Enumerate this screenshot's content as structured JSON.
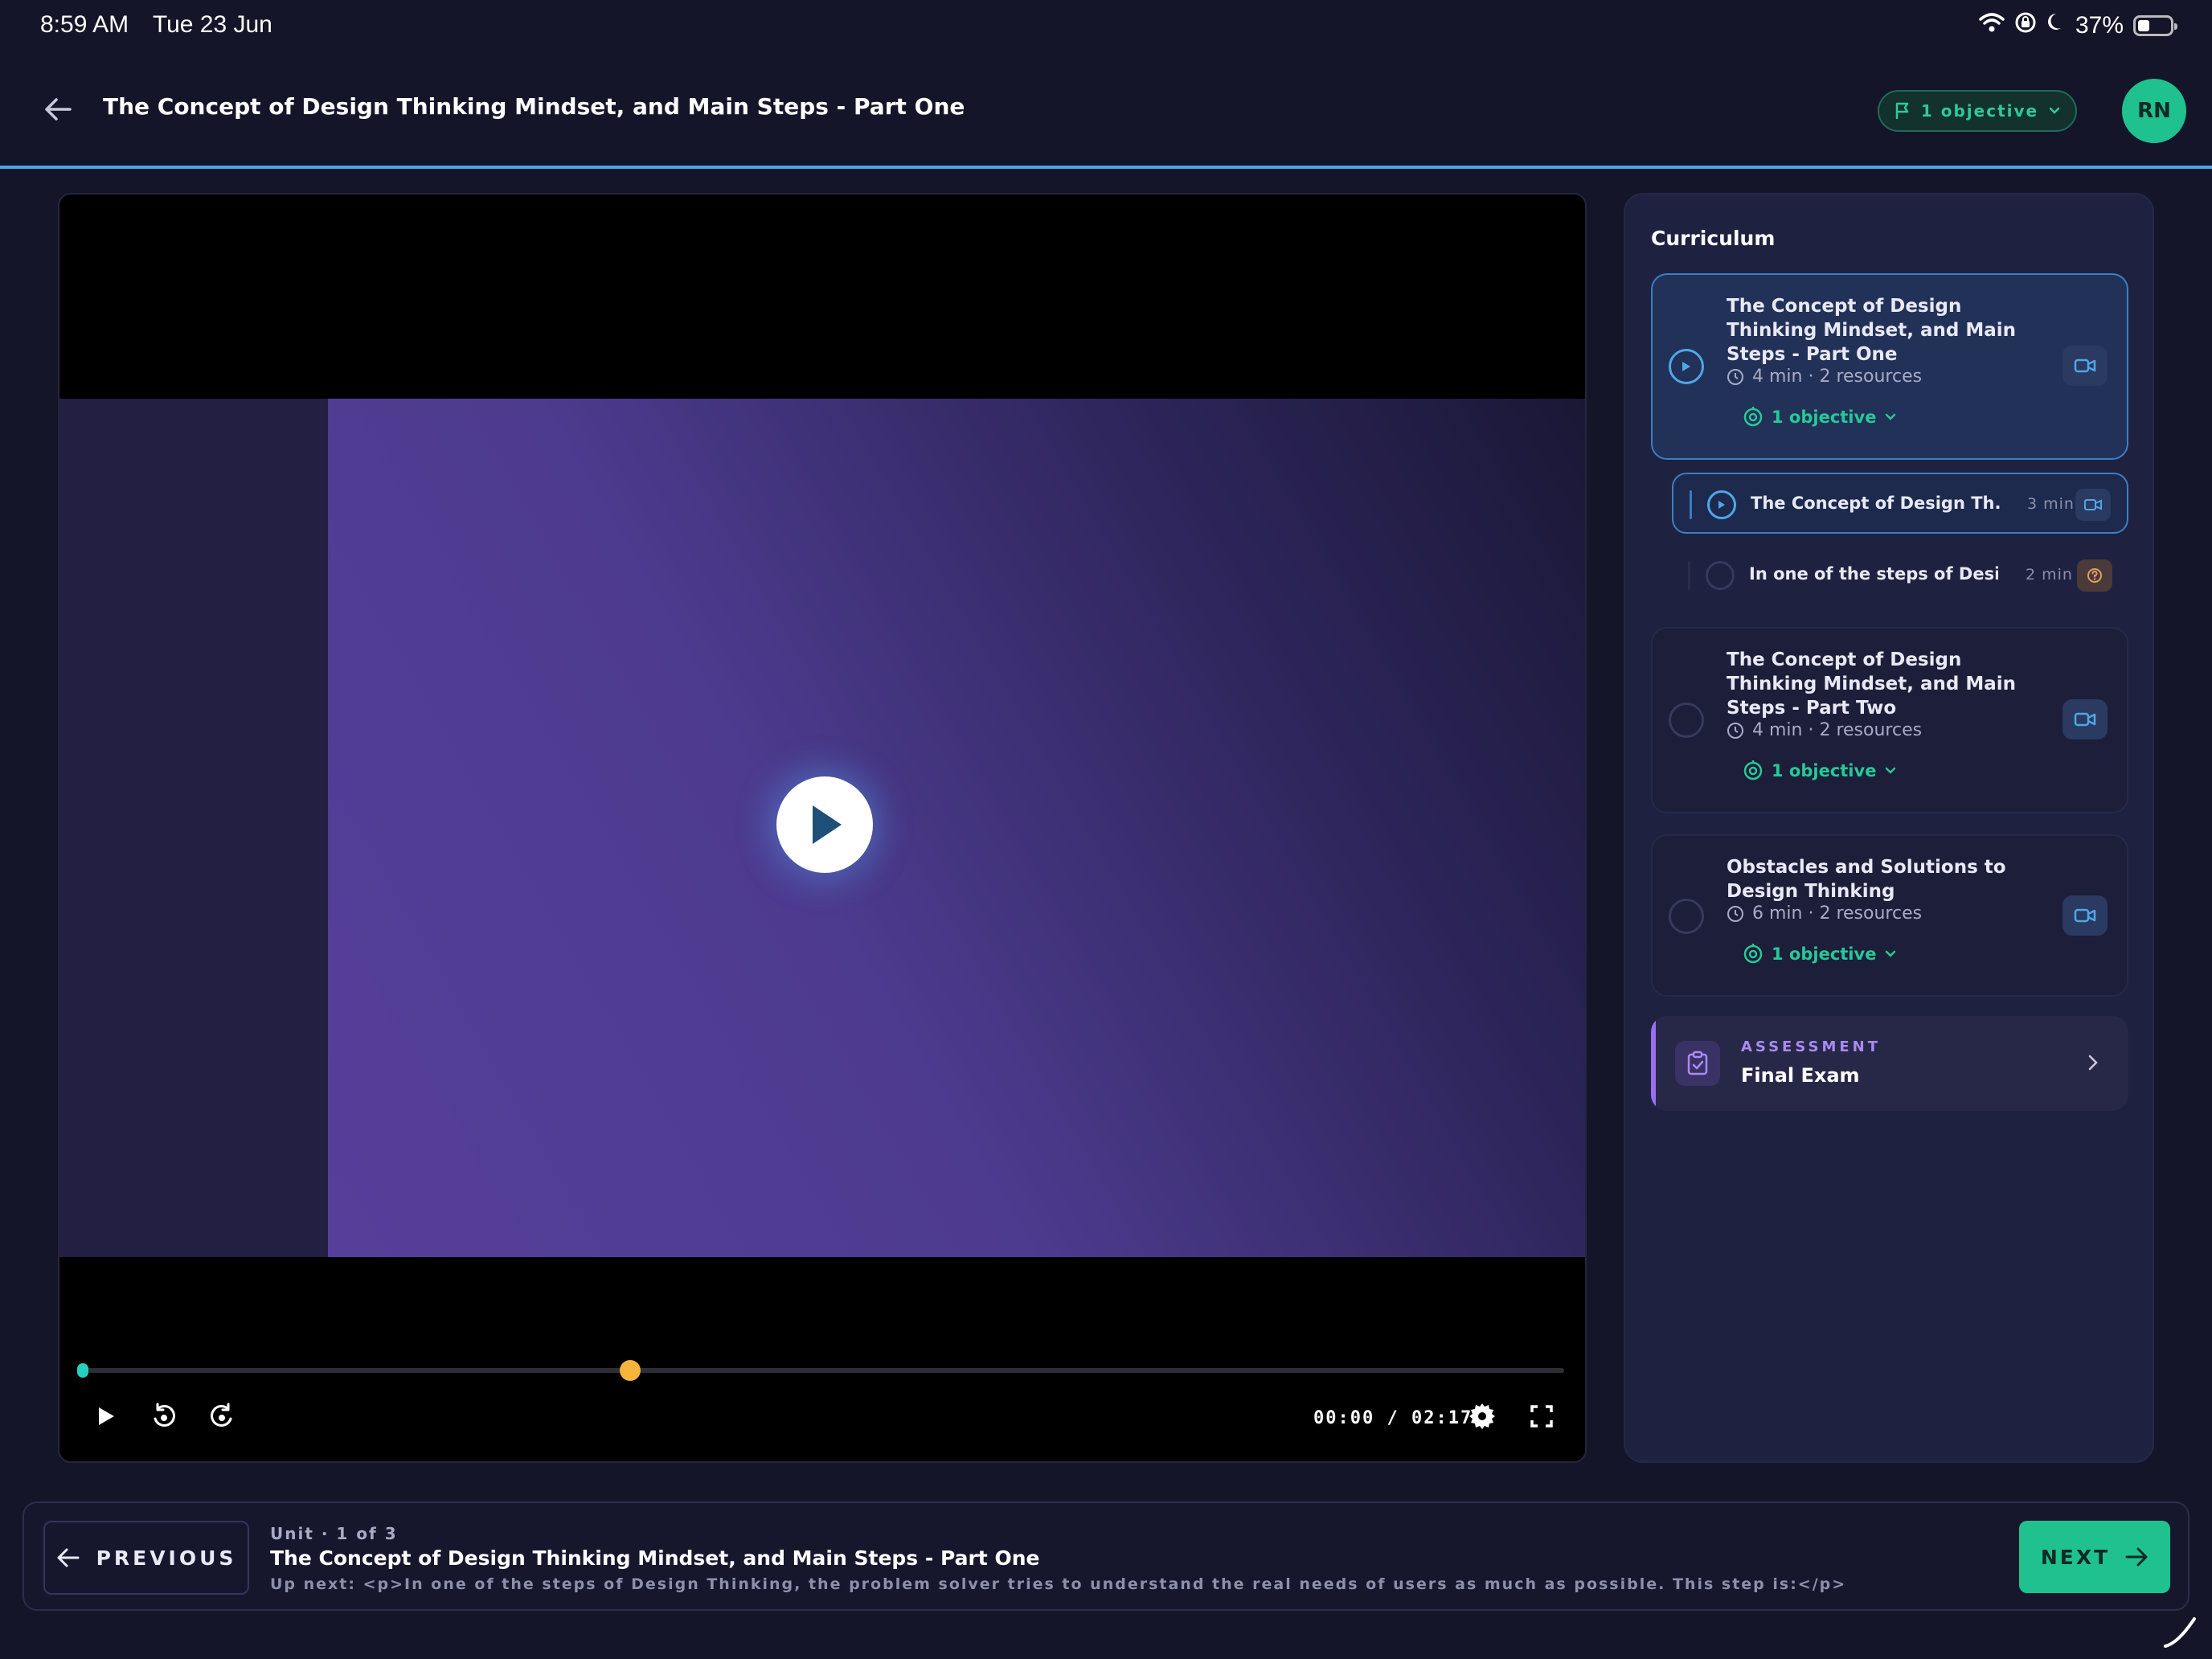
{
  "status_bar": {
    "time": "8:59 AM",
    "date": "Tue 23 Jun",
    "battery": "37%"
  },
  "header": {
    "title": "The Concept of Design Thinking Mindset, and Main Steps - Part One",
    "objective_pill": "1 objective",
    "avatar_initials": "RN"
  },
  "player": {
    "time": "00:00 / 02:17",
    "progress_fraction": 0.37
  },
  "curriculum": {
    "title": "Curriculum",
    "lessons": [
      {
        "title": "The Concept of Design Thinking Mindset, and Main Steps - Part One",
        "meta": "4 min · 2 resources",
        "objective": "1 objective",
        "items": [
          {
            "title": "The Concept of Design Th...",
            "duration": "3 min"
          },
          {
            "title": "In one of the steps of Desi...",
            "duration": "2 min"
          }
        ]
      },
      {
        "title": "The Concept of Design Thinking Mindset, and Main Steps - Part Two",
        "meta": "4 min · 2 resources",
        "objective": "1 objective"
      },
      {
        "title": "Obstacles and Solutions to Design Thinking",
        "meta": "6 min · 2 resources",
        "objective": "1 objective"
      }
    ],
    "assessment": {
      "kicker": "ASSESSMENT",
      "title": "Final Exam"
    }
  },
  "footer": {
    "previous_label": "PREVIOUS",
    "unit_meta": "Unit · 1 of 3",
    "unit_title": "The Concept of Design Thinking Mindset, and Main Steps - Part One",
    "up_next": "Up next: <p>In one of the steps of Design Thinking, the problem solver tries to understand the real needs of users as much as possible. This step is:</p>",
    "next_label": "NEXT"
  },
  "colors": {
    "background": "#141529",
    "accent_green": "#1fc28f",
    "accent_blue": "#4aa8e0",
    "assessment_purple": "#9b6ff0",
    "progress_thumb": "#f5b53c"
  }
}
